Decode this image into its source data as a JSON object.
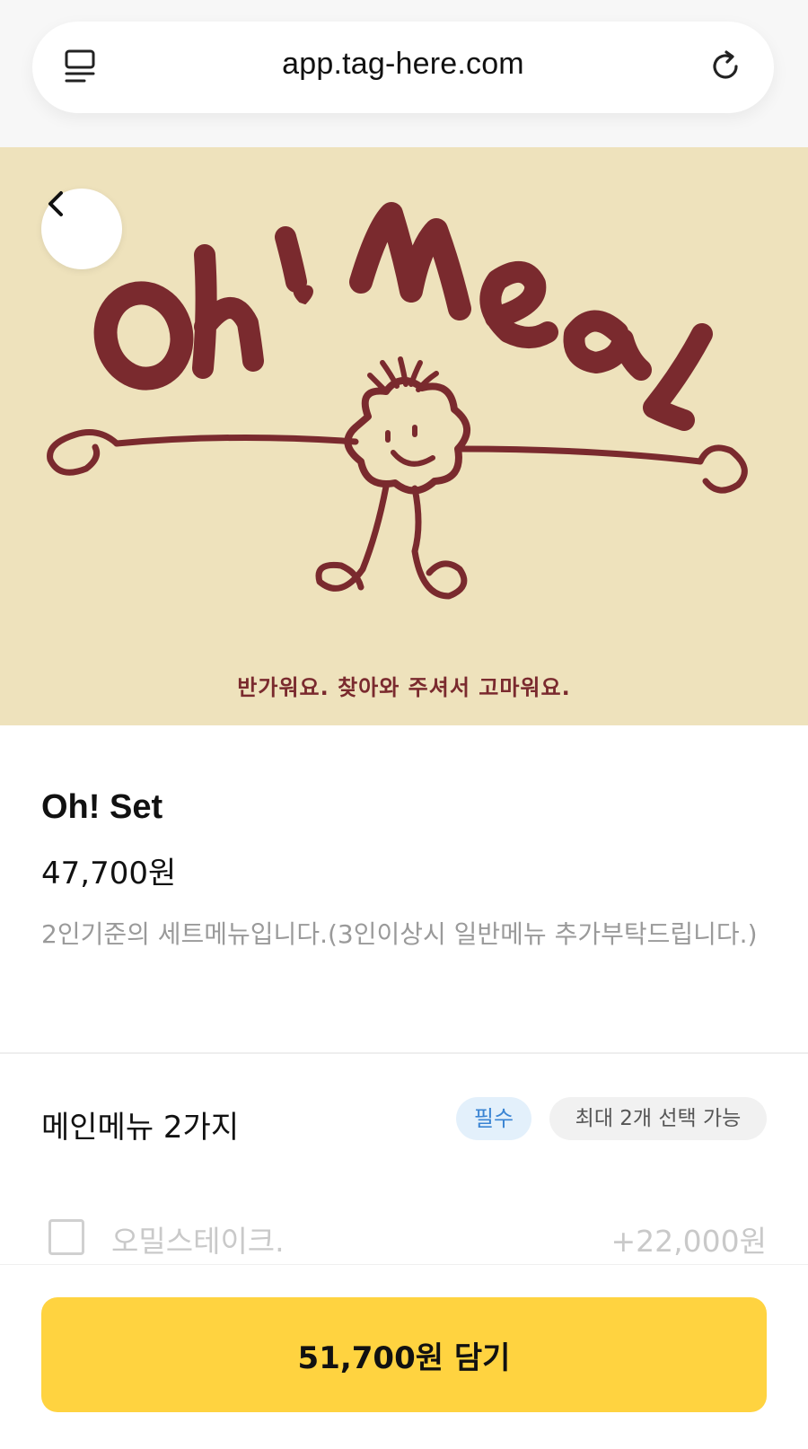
{
  "browser": {
    "url": "app.tag-here.com",
    "tabs_icon": "tabs-icon",
    "reload_icon": "reload-icon"
  },
  "hero": {
    "logo_text": "Oh! Meal",
    "caption": "반가워요. 찾아와 주셔서 고마워요.",
    "back_icon": "chevron-left-icon",
    "background_color": "#eee2bc",
    "ink_color": "#7a2a2e"
  },
  "product": {
    "name": "Oh! Set",
    "price": "47,700원",
    "description": "2인기준의 세트메뉴입니다.(3인이상시 일반메뉴 추가부탁드립니다.)"
  },
  "option_group": {
    "title": "메인메뉴 2가지",
    "required_badge": "필수",
    "max_badge": "최대 2개 선택 가능",
    "items": [
      {
        "label": "오밀스테이크.",
        "price": "+22,000원",
        "checked": false
      }
    ]
  },
  "footer": {
    "cart_button_label": "51,700원 담기",
    "accent_color": "#ffd340"
  }
}
